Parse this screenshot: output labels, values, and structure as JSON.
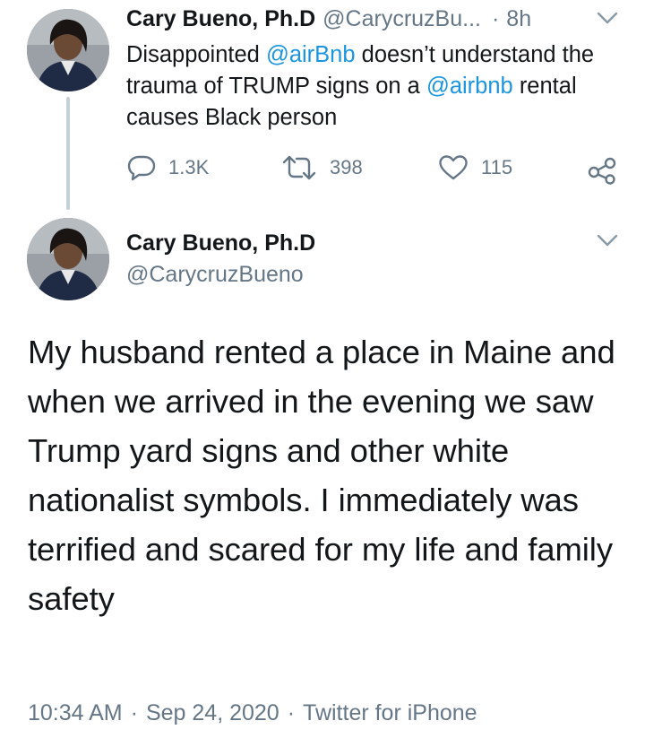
{
  "reply_tweet": {
    "author_name": "Cary Bueno, Ph.D",
    "author_handle": "@CarycruzBu...",
    "separator": "·",
    "time": "8h",
    "text_part1": "Disappointed ",
    "mention1": "@airBnb",
    "text_part2": " doesn’t understand the trauma of TRUMP signs on a ",
    "mention2": "@airbnb",
    "text_part3": " rental causes Black person",
    "replies_count": "1.3K",
    "retweets_count": "398",
    "likes_count": "115"
  },
  "main_tweet": {
    "author_name": "Cary Bueno, Ph.D",
    "author_handle": "@CarycruzBueno",
    "text": "My husband rented a place in Maine and when we arrived in the evening we saw Trump yard signs and other white nationalist symbols. I immediately was terrified and scared for my life and family safety",
    "time": "10:34 AM",
    "date": "Sep 24, 2020",
    "source": "Twitter for iPhone",
    "dot": "·"
  },
  "icons": {
    "reply": "reply-icon",
    "retweet": "retweet-icon",
    "like": "heart-icon",
    "share": "share-icon",
    "menu": "chevron-down-icon"
  },
  "colors": {
    "link": "#1b95e0",
    "secondary_text": "#657786",
    "thread_line": "#c4cfd6"
  }
}
